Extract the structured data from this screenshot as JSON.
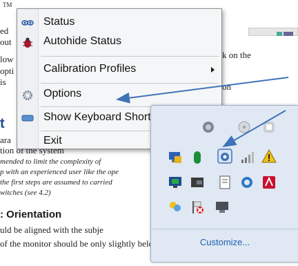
{
  "background_doc": {
    "lines_left": [
      "TM",
      "ed",
      "out",
      "low",
      "opti",
      "is"
    ],
    "line_right_1": "k on the",
    "line_right_2": "on",
    "line_right_2_suffix": "on",
    "heading_small": "t",
    "para_1": "ara",
    "para_2": "tion of the system",
    "italic_1": "mended to limit the complexity of",
    "italic_2": "p with an experienced user like the ope",
    "italic_3": "the first steps are assumed to carried",
    "italic_4": "witches (see 4.2)",
    "section_heading": ": Orientation",
    "body_1": "uld be aligned with the subje",
    "body_2": "of the monitor should be only slightly below the top"
  },
  "context_menu": {
    "items": [
      {
        "label": "Status",
        "icon": "eyes-icon"
      },
      {
        "label": "Autohide Status",
        "icon": "bug-icon"
      },
      {
        "label": "Calibration Profiles",
        "has_submenu": true
      },
      {
        "label": "Options",
        "icon": "gear-icon"
      },
      {
        "label": "Show Keyboard Shortcuts",
        "icon": "keyboard-icon"
      },
      {
        "label": "Exit"
      }
    ]
  },
  "tray": {
    "customize_label": "Customize..."
  },
  "colors": {
    "arrow": "#3f73b8",
    "menu_bg": "#f5f6f7",
    "tray_bg": "#dfe8f3",
    "link": "#1f5fb0"
  }
}
